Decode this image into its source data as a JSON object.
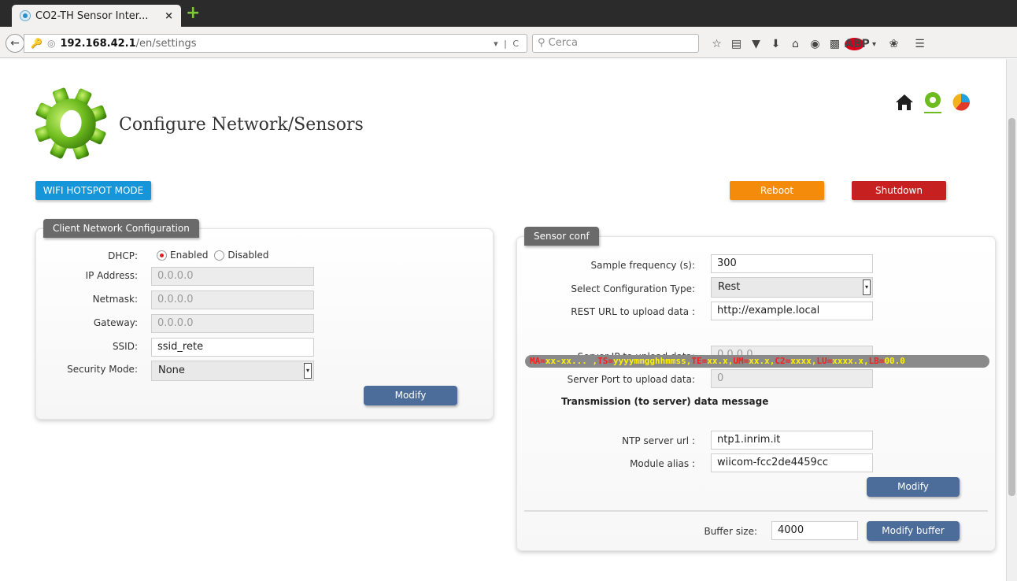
{
  "browser": {
    "tab_title": "CO2-TH Sensor Inter...",
    "tab_close": "×",
    "new_tab": "+",
    "url_host": "192.168.42.1",
    "url_path": "/en/settings",
    "search_placeholder": "Cerca"
  },
  "header": {
    "title": "Configure Network/Sensors"
  },
  "actions": {
    "wifi_label": "WIFI HOTSPOT MODE",
    "reboot_label": "Reboot",
    "shutdown_label": "Shutdown"
  },
  "client": {
    "legend": "Client Network Configuration",
    "dhcp_label": "DHCP:",
    "dhcp_enabled": "Enabled",
    "dhcp_disabled": "Disabled",
    "ip_label": "IP Address:",
    "ip_value": "0.0.0.0",
    "netmask_label": "Netmask:",
    "netmask_value": "0.0.0.0",
    "gateway_label": "Gateway:",
    "gateway_value": "0.0.0.0",
    "ssid_label": "SSID:",
    "ssid_value": "ssid_rete",
    "security_label": "Security Mode:",
    "security_value": "None",
    "modify_label": "Modify"
  },
  "sensor": {
    "legend": "Sensor conf",
    "freq_label": "Sample frequency (s):",
    "freq_value": "300",
    "conftype_label": "Select Configuration Type:",
    "conftype_value": "Rest",
    "resturl_label": "REST URL to upload data :",
    "resturl_value": "http://example.local",
    "serverip_label": "Server IP to upload data:",
    "serverip_value": "0.0.0.0",
    "serverport_label": "Server Port to upload data:",
    "serverport_value": "0",
    "transmission_title": "Transmission (to server) data message",
    "message": {
      "ma_k": "MA=",
      "ma_v": "xx-xx... ,",
      "ts_k": "TS=",
      "ts_v": "yyyymmgghhmmss,",
      "te_k": "TE=",
      "te_v": "xx.x,",
      "um_k": "UM=",
      "um_v": "xx.x,",
      "c2_k": "C2=",
      "c2_v": "xxxx,",
      "lu_k": "LU=",
      "lu_v": "xxxx.x,",
      "lb_k": "LB=",
      "lb_v": "00.0"
    },
    "ntp_label": "NTP server url :",
    "ntp_value": "ntp1.inrim.it",
    "alias_label": "Module alias :",
    "alias_value": "wiicom-fcc2de4459cc",
    "modify_label": "Modify",
    "buffer_label": "Buffer size:",
    "buffer_value": "4000",
    "modify_buffer_label": "Modify buffer"
  },
  "colors": {
    "wifi": "#1696d8",
    "reboot": "#f58b0a",
    "shutdown": "#c62020",
    "modify": "#4c6c9a"
  }
}
